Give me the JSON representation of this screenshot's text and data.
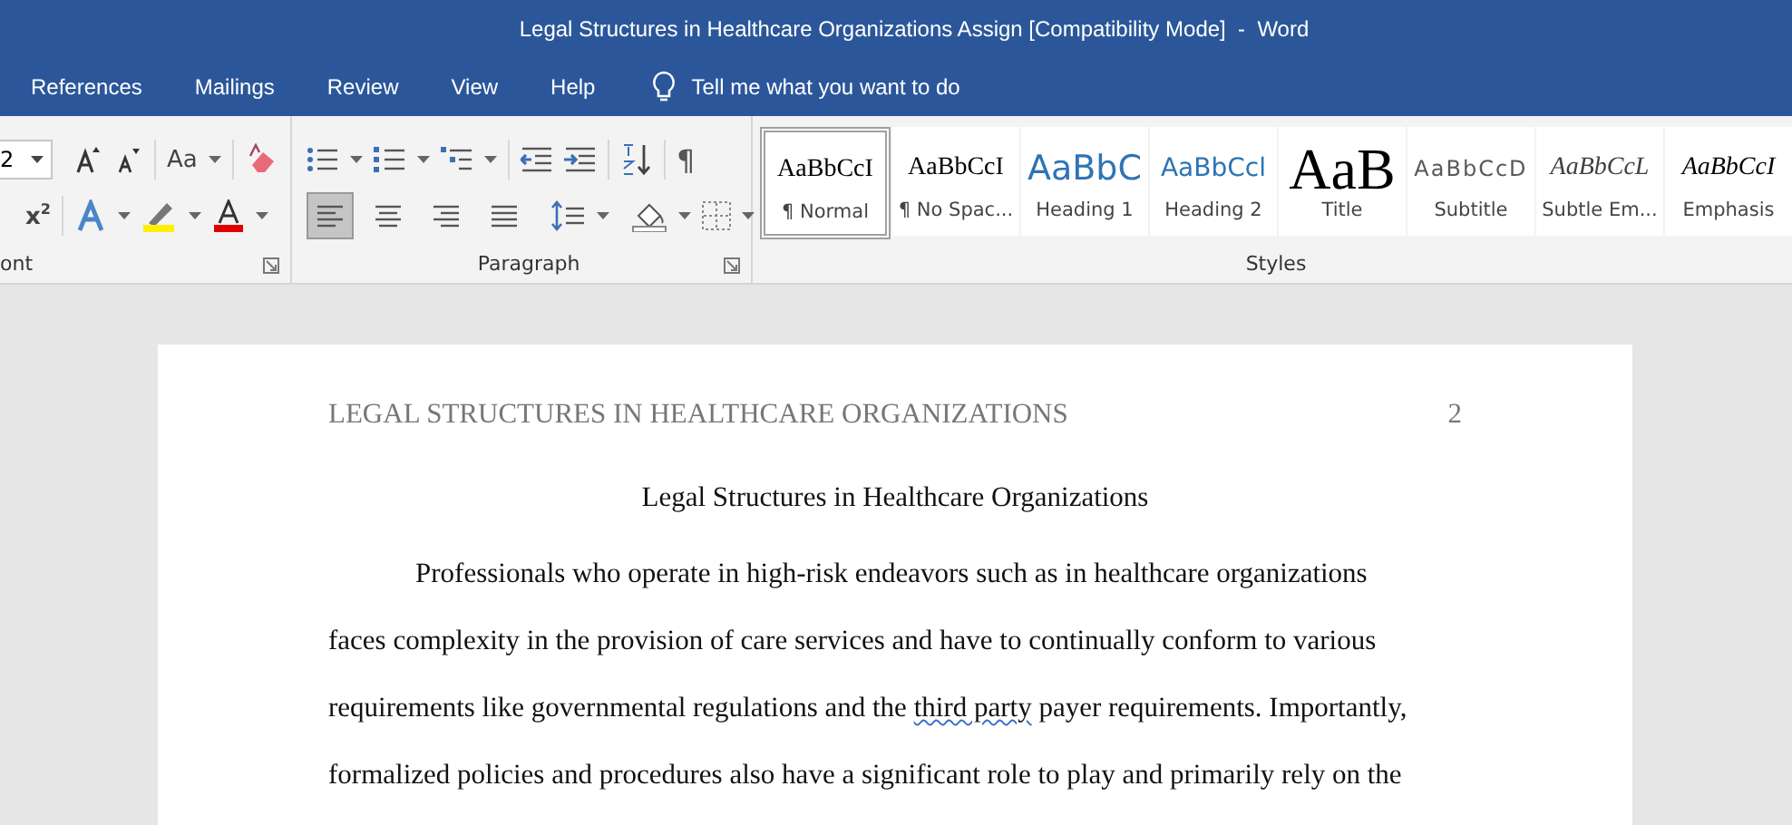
{
  "window": {
    "title": "Legal Structures in Healthcare Organizations Assign [Compatibility Mode]  -  Word"
  },
  "tabs": [
    {
      "label": "References",
      "selected": false
    },
    {
      "label": "Mailings",
      "selected": false
    },
    {
      "label": "Review",
      "selected": false
    },
    {
      "label": "View",
      "selected": false
    },
    {
      "label": "Help",
      "selected": false
    }
  ],
  "tell_me": {
    "placeholder": "Tell me what you want to do"
  },
  "font_group": {
    "label": "ont",
    "font_size": "2",
    "change_case": "Aa",
    "superscript": "x$^{2}$"
  },
  "paragraph_group": {
    "label": "Paragraph",
    "show_marks": "¶",
    "align_buttons": [
      {
        "kind": "left",
        "selected": true
      },
      {
        "kind": "center",
        "selected": false
      },
      {
        "kind": "right",
        "selected": false
      },
      {
        "kind": "justify",
        "selected": false
      }
    ]
  },
  "styles_group": {
    "label": "Styles",
    "styles": [
      {
        "kind": "normal",
        "preview": "AaBbCcI",
        "name": "¶ Normal",
        "selected": true
      },
      {
        "kind": "no_spacing",
        "preview": "AaBbCcI",
        "name": "¶ No Spac...",
        "selected": false
      },
      {
        "kind": "heading1",
        "preview": "AaBbC",
        "name": "Heading 1",
        "selected": false
      },
      {
        "kind": "heading2",
        "preview": "AaBbCcl",
        "name": "Heading 2",
        "selected": false
      },
      {
        "kind": "title",
        "preview": "AaB",
        "name": "Title",
        "selected": false
      },
      {
        "kind": "subtitle",
        "preview": "AaBbCcD",
        "name": "Subtitle",
        "selected": false
      },
      {
        "kind": "subtle_emphasis",
        "preview": "AaBbCcL",
        "name": "Subtle Em...",
        "selected": false
      },
      {
        "kind": "emphasis",
        "preview": "AaBbCcI",
        "name": "Emphasis",
        "selected": false
      }
    ]
  },
  "document": {
    "header": "LEGAL STRUCTURES IN HEALTHCARE ORGANIZATIONS",
    "page_number": "2",
    "title": "Legal Structures in Healthcare Organizations",
    "lines": [
      [
        {
          "text": "Professionals who operate in high-risk endeavors such as in healthcare organizations",
          "flagged": false
        }
      ],
      [
        {
          "text": "faces complexity in the provision of care services and have to continually conform to various",
          "flagged": false
        }
      ],
      [
        {
          "text": "requirements like governmental regulations and the ",
          "flagged": false
        },
        {
          "text": "third party",
          "flagged": true
        },
        {
          "text": " payer requirements. Importantly,",
          "flagged": false
        }
      ],
      [
        {
          "text": "formalized policies and procedures also have a significant role to play and primarily rely on the",
          "flagged": false
        }
      ]
    ]
  }
}
